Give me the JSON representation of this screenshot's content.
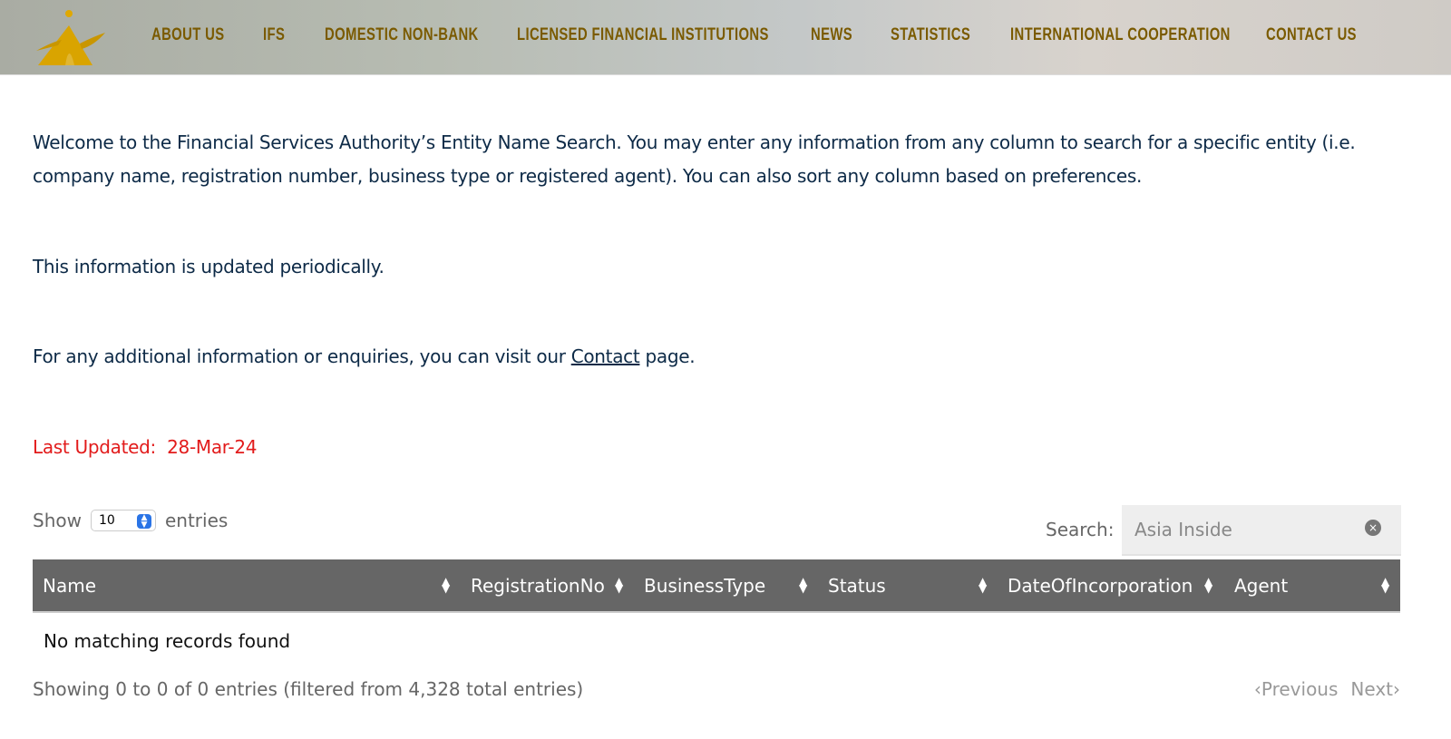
{
  "nav": {
    "items": [
      "ABOUT US",
      "IFS",
      "DOMESTIC NON-BANK",
      "LICENSED FINANCIAL INSTITUTIONS",
      "NEWS",
      "STATISTICS",
      "INTERNATIONAL COOPERATION",
      "CONTACT US"
    ],
    "color": "#7a5a00"
  },
  "intro": {
    "line1": "Welcome to the Financial Services Authority’s Entity Name Search. You may enter any information from any column to search for a specific entity (i.e.",
    "line2": "company name, registration number, business type or registered agent). You can also sort any column based on preferences.",
    "periodic": "This information is updated periodically.",
    "contact_pre": "For any additional information or enquiries, you can visit our ",
    "contact_link": "Contact",
    "contact_post": " page.",
    "updated_label": "Last Updated:",
    "updated_value": "28-Mar-24"
  },
  "table_controls": {
    "show": "Show",
    "entries_value": "10",
    "entries": "entries",
    "search_label": "Search:",
    "search_value": "Asia Inside"
  },
  "table": {
    "columns": [
      "Name",
      "RegistrationNo",
      "BusinessType",
      "Status",
      "DateOfIncorporation",
      "Agent"
    ],
    "empty": "No matching records found"
  },
  "footer": {
    "info": "Showing 0 to 0 of 0 entries (filtered from 4,328 total entries)",
    "previous": "Previous",
    "next": "Next"
  }
}
